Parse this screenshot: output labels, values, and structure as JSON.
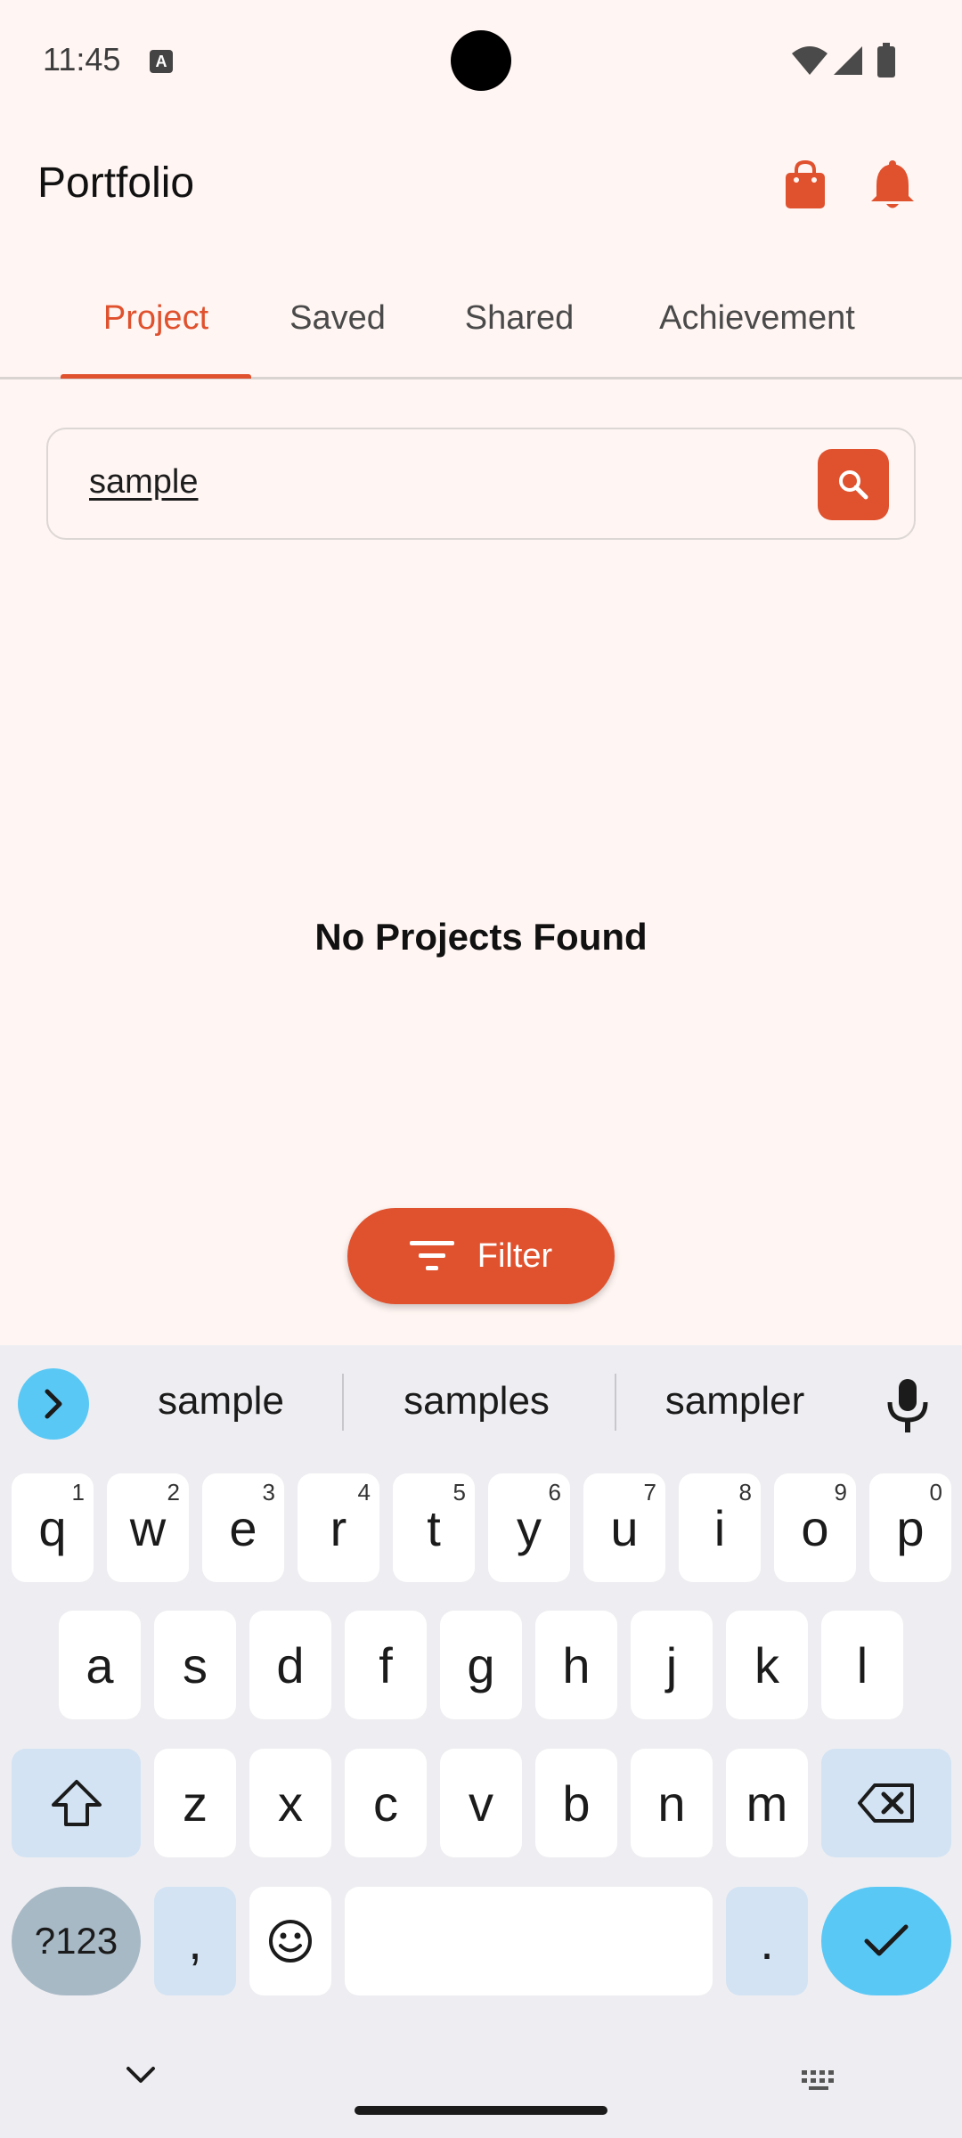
{
  "status_bar": {
    "time": "11:45",
    "input_badge": "A"
  },
  "app_bar": {
    "title": "Portfolio"
  },
  "tabs": [
    {
      "label": "Project",
      "active": true
    },
    {
      "label": "Saved",
      "active": false
    },
    {
      "label": "Shared",
      "active": false
    },
    {
      "label": "Achievement",
      "active": false
    }
  ],
  "search": {
    "value": "sample"
  },
  "empty_state": {
    "message": "No Projects Found"
  },
  "filter": {
    "label": "Filter"
  },
  "keyboard": {
    "suggestions": [
      "sample",
      "samples",
      "sampler"
    ],
    "row1": [
      {
        "key": "q",
        "hint": "1"
      },
      {
        "key": "w",
        "hint": "2"
      },
      {
        "key": "e",
        "hint": "3"
      },
      {
        "key": "r",
        "hint": "4"
      },
      {
        "key": "t",
        "hint": "5"
      },
      {
        "key": "y",
        "hint": "6"
      },
      {
        "key": "u",
        "hint": "7"
      },
      {
        "key": "i",
        "hint": "8"
      },
      {
        "key": "o",
        "hint": "9"
      },
      {
        "key": "p",
        "hint": "0"
      }
    ],
    "row2": [
      "a",
      "s",
      "d",
      "f",
      "g",
      "h",
      "j",
      "k",
      "l"
    ],
    "row3": [
      "z",
      "x",
      "c",
      "v",
      "b",
      "n",
      "m"
    ],
    "symbols_label": "?123",
    "comma": ",",
    "period": "."
  },
  "colors": {
    "accent": "#E0512E",
    "background": "#FFF5F2",
    "keyboard_accent": "#5AC8F5"
  }
}
